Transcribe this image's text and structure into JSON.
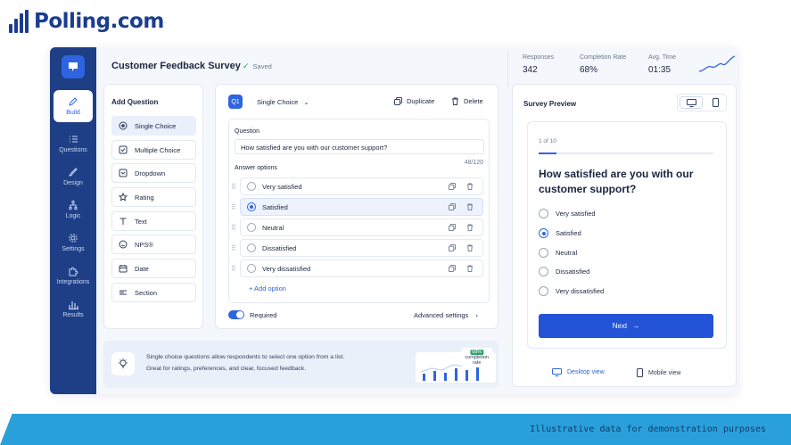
{
  "brand": {
    "name": "Polling.com"
  },
  "survey": {
    "title": "Customer Feedback Survey",
    "saved": "Saved"
  },
  "stats": [
    {
      "label": "Responses",
      "value": "342"
    },
    {
      "label": "Completion Rate",
      "value": "68%"
    },
    {
      "label": "Avg. Time",
      "value": "01:35"
    }
  ],
  "sidebar": {
    "items": [
      {
        "label": "Build",
        "icon": "pencil-icon"
      },
      {
        "label": "Questions",
        "icon": "list-icon"
      },
      {
        "label": "Design",
        "icon": "brush-icon"
      },
      {
        "label": "Logic",
        "icon": "branch-icon"
      },
      {
        "label": "Settings",
        "icon": "gear-icon"
      },
      {
        "label": "Integrations",
        "icon": "puzzle-icon"
      },
      {
        "label": "Results",
        "icon": "bar-chart-icon"
      }
    ]
  },
  "add_question": {
    "title": "Add Question",
    "types": [
      "Single Choice",
      "Multiple Choice",
      "Dropdown",
      "Rating",
      "Text",
      "NPS®",
      "Date",
      "Section"
    ]
  },
  "editor": {
    "badge": "Q1",
    "type": "Single Choice",
    "duplicate": "Duplicate",
    "delete": "Delete",
    "question_label": "Question",
    "question_text": "How satisfied are you with our customer support?",
    "char_count": "48/120",
    "answers_label": "Answer options",
    "options": [
      "Very satisfied",
      "Satisfied",
      "Neutral",
      "Dissatisfied",
      "Very dissatisfied"
    ],
    "selected_index": 1,
    "add_option": "+ Add option",
    "required": "Required",
    "advanced": "Advanced settings"
  },
  "tip": {
    "line1": "Single choice questions allow respondents to select one option from a list.",
    "line2": "Great for ratings, preferences, and clear, focused feedback.",
    "chart_badge": "68%",
    "chart_label": "completion rate"
  },
  "preview": {
    "title": "Survey Preview",
    "progress_text": "1 of 10",
    "progress": 0.1,
    "question": "How satisfied are you with our customer support?",
    "options": [
      "Very satisfied",
      "Satisfied",
      "Neutral",
      "Dissatisfied",
      "Very dissatisfied"
    ],
    "selected_index": 1,
    "next": "Next",
    "desktop_view": "Desktop view",
    "mobile_view": "Mobile view"
  },
  "footer": {
    "text": "Illustrative data for demonstration purposes"
  },
  "colors": {
    "accent": "#2f64e0",
    "sidebar": "#1e3f86",
    "footer": "#2aa0db"
  }
}
